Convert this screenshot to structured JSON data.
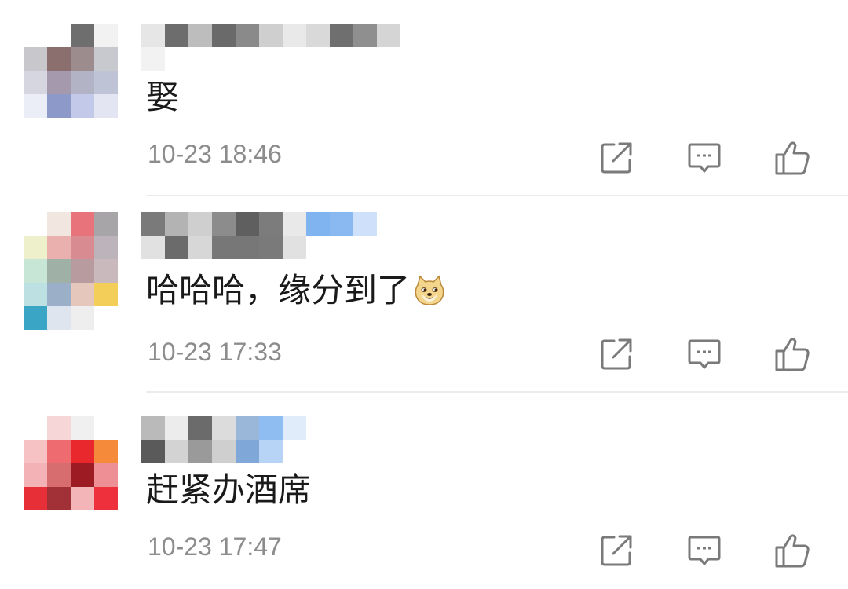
{
  "colors": {
    "text": "#1a1a1a",
    "meta": "#8c8c8c",
    "icon": "#7a7a7a",
    "divider": "#ececec"
  },
  "icons": {
    "share": "share-icon",
    "reply": "reply-icon",
    "like": "thumbs-up-icon",
    "emoji": "doge-emoji-icon"
  },
  "comments": [
    {
      "text": "娶",
      "emoji": "",
      "time": "10-23 18:46",
      "avatar_colors": [
        "#ffffff",
        "#ffffff",
        "#6e6e6e",
        "#f2f2f2",
        "#c8c8cc",
        "#8a6f6e",
        "#9d8c8e",
        "#c7c9cf",
        "#d6d6e0",
        "#a599ad",
        "#b3b3c6",
        "#bfc3d6",
        "#ebeef7",
        "#8d99c9",
        "#c3cae9",
        "#e3e6f2"
      ],
      "username_colors": [
        "#e6e6e6",
        "#6d6d6d",
        "#bdbdbd",
        "#6a6a6a",
        "#8a8a8a",
        "#cfcfcf",
        "#e9e9e9",
        "#d9d9d9",
        "#6f6f6f",
        "#8f8f8f",
        "#d5d5d5",
        "#f2f2f2",
        "#ffffff",
        "#ffffff",
        "#ffffff",
        "#ffffff",
        "#ffffff",
        "#ffffff",
        "#ffffff",
        "#ffffff",
        "#ffffff",
        "#ffffff"
      ]
    },
    {
      "text": "哈哈哈，缘分到了",
      "emoji": "doge",
      "time": "10-23 17:33",
      "avatar_colors": [
        "#ffffff",
        "#f1e7e0",
        "#e8737b",
        "#a8a5a8",
        "#eef0cc",
        "#e9b0ad",
        "#d88c92",
        "#bdb3ba",
        "#c8e6d5",
        "#9fb0a6",
        "#b89b9e",
        "#c9b8bc",
        "#bde1e2",
        "#9bb0c8",
        "#e6c7bb",
        "#f3cf5a",
        "#3aa5c4",
        "#dfe5ee",
        "#eeeeee",
        "#ffffff"
      ],
      "username_colors": [
        "#7a7a7a",
        "#b3b3b3",
        "#cfcfcf",
        "#8c8c8c",
        "#5f5f5f",
        "#7c7c7c",
        "#e9e9e9",
        "#7fb4f0",
        "#8ab9f2",
        "#cfe1fa",
        "#e1e1e1",
        "#6b6b6b",
        "#d7d7d7",
        "#777777",
        "#777777",
        "#7a7a7a",
        "#e1e1e1",
        "#ffffff",
        "#ffffff",
        "#ffffff"
      ]
    },
    {
      "text": "赶紧办酒席",
      "emoji": "",
      "time": "10-23 17:47",
      "avatar_colors": [
        "#ffffff",
        "#f7d6d8",
        "#f0f0f0",
        "#ffffff",
        "#f7c2c4",
        "#ee6b6f",
        "#e8282c",
        "#f48a3a",
        "#f3b3b6",
        "#d86d70",
        "#9d1c23",
        "#ee8f95",
        "#e72f38",
        "#a13037",
        "#f4b5b9",
        "#ee2f3c"
      ],
      "username_colors": [
        "#bababa",
        "#ececec",
        "#6b6b6b",
        "#dcdcdc",
        "#9ab7d9",
        "#8fbdf2",
        "#e1ecfb",
        "#5a5a5a",
        "#d3d3d3",
        "#9a9a9a",
        "#cfcfcf",
        "#7fa8d8",
        "#b7d4f7",
        "#ffffff"
      ]
    }
  ]
}
